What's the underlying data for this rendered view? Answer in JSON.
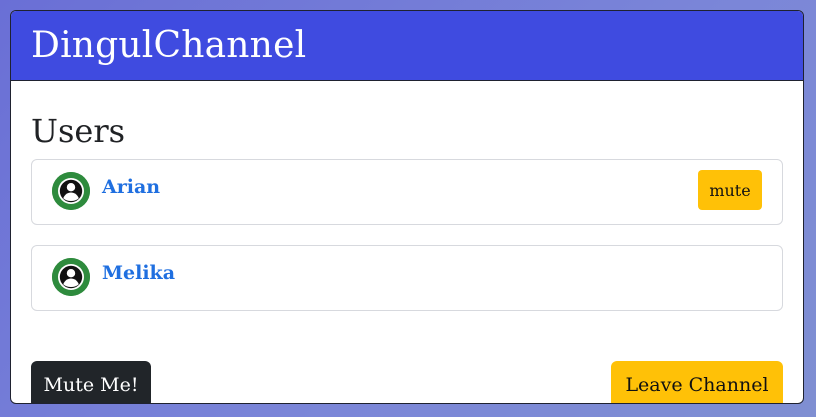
{
  "app": {
    "title": "DingulChannel"
  },
  "users_section": {
    "title": "Users",
    "users": [
      {
        "name": "Arian",
        "avatar_icon": "user-circle-icon",
        "action_label": "mute"
      },
      {
        "name": "Melika",
        "avatar_icon": "user-circle-icon"
      }
    ]
  },
  "actions": {
    "mute_me_label": "Mute Me!",
    "leave_channel_label": "Leave Channel"
  },
  "colors": {
    "header": "#3f4be0",
    "username": "#1f6fe0",
    "warning": "#ffc107",
    "dark": "#212529",
    "avatar": "#2e8b3d"
  }
}
